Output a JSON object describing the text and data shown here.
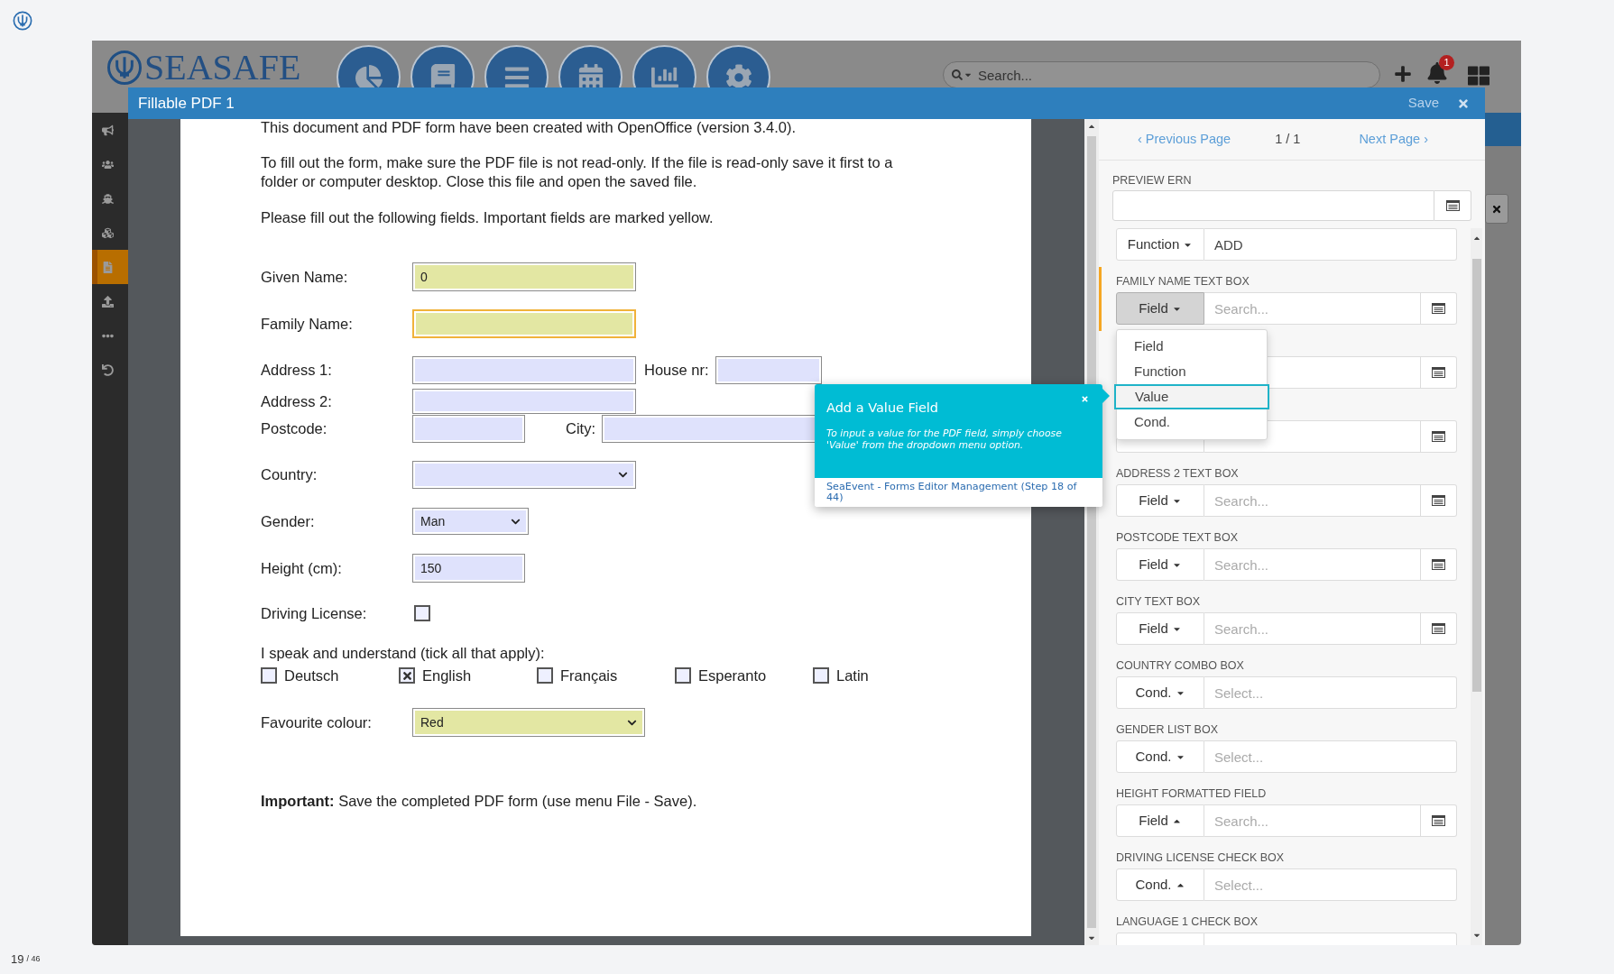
{
  "page_counter": {
    "current": "19",
    "total": "/ 46"
  },
  "app": {
    "logo_text": "SEASAFE",
    "search": {
      "placeholder": "Search..."
    },
    "notifications": "1"
  },
  "sidebar_items": [
    {
      "selected": false
    },
    {
      "selected": false
    },
    {
      "selected": false
    },
    {
      "selected": false
    },
    {
      "selected": true
    },
    {
      "selected": false
    },
    {
      "selected": false
    },
    {
      "selected": false
    }
  ],
  "modal": {
    "title": "Fillable PDF 1",
    "save": "Save"
  },
  "document": {
    "paragraphs": [
      "This document and PDF form have been created with OpenOffice (version 3.4.0).",
      "To fill out the form, make sure the PDF file is not read-only. If the file is read-only save it first to a folder or computer desktop. Close this file and open the saved file.",
      "Please fill out the following fields. Important fields are marked yellow."
    ],
    "fields": [
      {
        "kind": "text",
        "label": "Given Name:",
        "value": "0",
        "required": true,
        "focused": false
      },
      {
        "kind": "text",
        "label": "Family Name:",
        "required": true,
        "focused": true
      },
      {
        "kind": "text",
        "label": "Address 1:",
        "required": false,
        "focused": false
      },
      {
        "kind": "text",
        "label": "House nr:",
        "required": false,
        "focused": false
      },
      {
        "kind": "text",
        "label": "Address 2:",
        "required": false,
        "focused": false
      },
      {
        "kind": "text",
        "label": "Postcode:",
        "required": false,
        "focused": false
      },
      {
        "kind": "text",
        "label": "City:",
        "required": false,
        "focused": false
      },
      {
        "kind": "select",
        "label": "Country:",
        "required": false,
        "focused": false
      },
      {
        "kind": "select",
        "label": "Gender:",
        "value": "Man",
        "required": false,
        "focused": false
      },
      {
        "kind": "text",
        "label": "Height (cm):",
        "value": "150",
        "required": false,
        "focused": false
      },
      {
        "kind": "checkbox",
        "label": "Driving License:",
        "checked": false
      }
    ],
    "languages": {
      "label": "I speak and understand (tick all that apply):",
      "options": [
        {
          "label": "Deutsch",
          "checked": false
        },
        {
          "label": "English",
          "checked": true
        },
        {
          "label": "Français",
          "checked": false
        },
        {
          "label": "Esperanto",
          "checked": false
        },
        {
          "label": "Latin",
          "checked": false
        }
      ]
    },
    "favourite": {
      "kind": "select",
      "label": "Favourite colour:",
      "value": "Red",
      "required": true,
      "focused": false
    },
    "note": "**Important:** Save the completed PDF form (use menu File - Save)."
  },
  "panel": {
    "previous": "‹ Previous Page",
    "page": "1 / 1",
    "next": "Next Page ›",
    "preview_label": "PREVIEW ERN",
    "mappings": [
      {
        "kind": "value",
        "mode": "Function",
        "caret_up": false,
        "value": "ADD",
        "open": false
      },
      {
        "kind": "search",
        "label": "FAMILY NAME TEXT BOX",
        "mode": "Field",
        "caret_up": false,
        "placeholder": "Search...",
        "open": true
      },
      {
        "kind": "covered"
      },
      {
        "kind": "covered"
      },
      {
        "kind": "search",
        "label": "ADDRESS 2 TEXT BOX",
        "mode": "Field",
        "caret_up": false,
        "placeholder": "Search...",
        "open": false
      },
      {
        "kind": "search",
        "label": "POSTCODE TEXT BOX",
        "mode": "Field",
        "caret_up": false,
        "placeholder": "Search...",
        "open": false
      },
      {
        "kind": "search",
        "label": "CITY TEXT BOX",
        "mode": "Field",
        "caret_up": false,
        "placeholder": "Search...",
        "open": false
      },
      {
        "kind": "select",
        "label": "COUNTRY COMBO BOX",
        "mode": "Cond.",
        "caret_up": false,
        "placeholder": "Select...",
        "open": false
      },
      {
        "kind": "select",
        "label": "GENDER LIST BOX",
        "mode": "Cond.",
        "caret_up": false,
        "placeholder": "Select...",
        "open": false
      },
      {
        "kind": "search",
        "label": "HEIGHT FORMATTED FIELD",
        "mode": "Field",
        "caret_up": true,
        "placeholder": "Search...",
        "open": false
      },
      {
        "kind": "select",
        "label": "DRIVING LICENSE CHECK BOX",
        "mode": "Cond.",
        "caret_up": true,
        "placeholder": "Select...",
        "open": false
      },
      {
        "kind": "cut",
        "label": "LANGUAGE 1 CHECK BOX"
      }
    ],
    "menu": {
      "options": [
        {
          "label": "Field",
          "selected": false
        },
        {
          "label": "Function",
          "selected": false
        },
        {
          "label": "Value",
          "selected": true
        },
        {
          "label": "Cond.",
          "selected": false
        }
      ]
    }
  },
  "popup": {
    "title": "Add a Value Field",
    "body": "To input a value for the PDF field, simply choose 'Value' from the dropdown menu option.",
    "footer": "SeaEvent - Forms Editor Management (Step 18 of 44)"
  }
}
